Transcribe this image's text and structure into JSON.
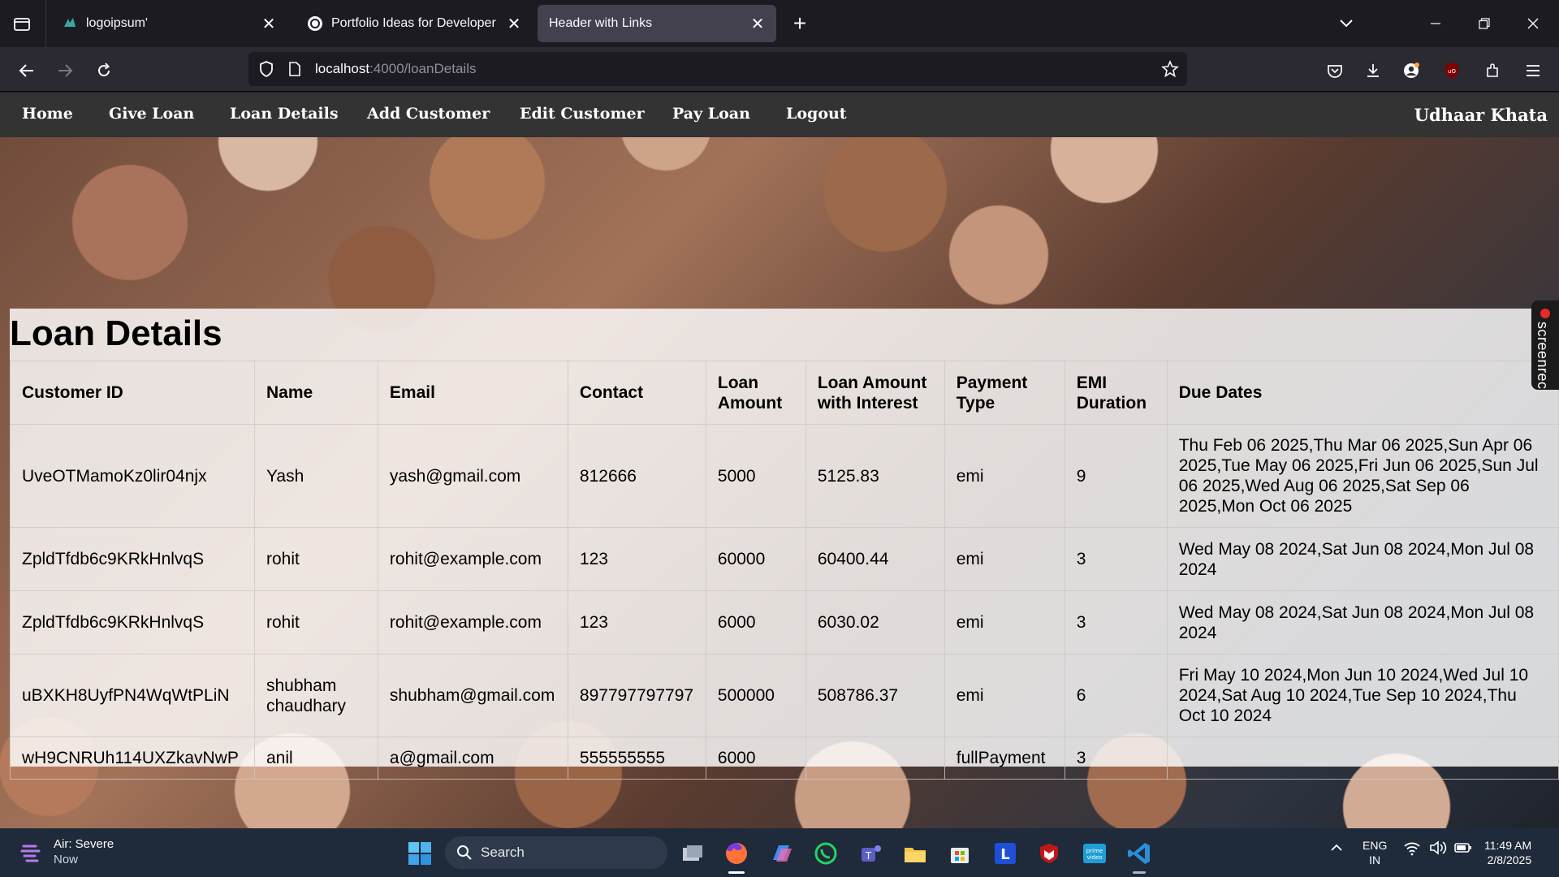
{
  "browser": {
    "tabs": [
      {
        "title": "logoipsum'",
        "active": false
      },
      {
        "title": "Portfolio Ideas for Developer",
        "active": false
      },
      {
        "title": "Header with Links",
        "active": true
      }
    ],
    "url_host": "localhost",
    "url_path": ":4000/loanDetails"
  },
  "site": {
    "nav": [
      "Home",
      "Give Loan",
      "Loan Details",
      "Add Customer",
      "Edit Customer",
      "Pay Loan",
      "Logout"
    ],
    "brand": "Udhaar Khata",
    "page_title": "Loan Details"
  },
  "table": {
    "headers": {
      "customer_id": "Customer ID",
      "name": "Name",
      "email": "Email",
      "contact": "Contact",
      "loan_amount_1": "Loan",
      "loan_amount_2": "Amount",
      "interest_1": "Loan Amount",
      "interest_2": "with Interest",
      "payment_1": "Payment",
      "payment_2": "Type",
      "emi_1": "EMI",
      "emi_2": "Duration",
      "due_dates": "Due Dates"
    },
    "rows": [
      {
        "id": "UveOTMamoKz0lir04njx",
        "name": "Yash",
        "email": "yash@gmail.com",
        "contact": "812666",
        "amount": "5000",
        "with_interest": "5125.83",
        "payment": "emi",
        "emi": "9",
        "due": "Thu Feb 06 2025,Thu Mar 06 2025,Sun Apr 06 2025,Tue May 06 2025,Fri Jun 06 2025,Sun Jul 06 2025,Wed Aug 06 2025,Sat Sep 06 2025,Mon Oct 06 2025"
      },
      {
        "id": "ZpldTfdb6c9KRkHnlvqS",
        "name": "rohit",
        "email": "rohit@example.com",
        "contact": "123",
        "amount": "60000",
        "with_interest": "60400.44",
        "payment": "emi",
        "emi": "3",
        "due": "Wed May 08 2024,Sat Jun 08 2024,Mon Jul 08 2024"
      },
      {
        "id": "ZpldTfdb6c9KRkHnlvqS",
        "name": "rohit",
        "email": "rohit@example.com",
        "contact": "123",
        "amount": "6000",
        "with_interest": "6030.02",
        "payment": "emi",
        "emi": "3",
        "due": "Wed May 08 2024,Sat Jun 08 2024,Mon Jul 08 2024"
      },
      {
        "id": "uBXKH8UyfPN4WqWtPLiN",
        "name": "shubham chaudhary",
        "email": "shubham@gmail.com",
        "contact": "897797797797",
        "amount": "500000",
        "with_interest": "508786.37",
        "payment": "emi",
        "emi": "6",
        "due": "Fri May 10 2024,Mon Jun 10 2024,Wed Jul 10 2024,Sat Aug 10 2024,Tue Sep 10 2024,Thu Oct 10 2024"
      },
      {
        "id": "wH9CNRUh114UXZkavNwP",
        "name": "anil",
        "email": "a@gmail.com",
        "contact": "555555555",
        "amount": "6000",
        "with_interest": "",
        "payment": "fullPayment",
        "emi": "3",
        "due": ""
      }
    ]
  },
  "screenrec_label": "screenrec",
  "taskbar": {
    "weather_title": "Air: Severe",
    "weather_sub": "Now",
    "search_label": "Search",
    "lang_1": "ENG",
    "lang_2": "IN",
    "time": "11:49 AM",
    "date": "2/8/2025"
  }
}
